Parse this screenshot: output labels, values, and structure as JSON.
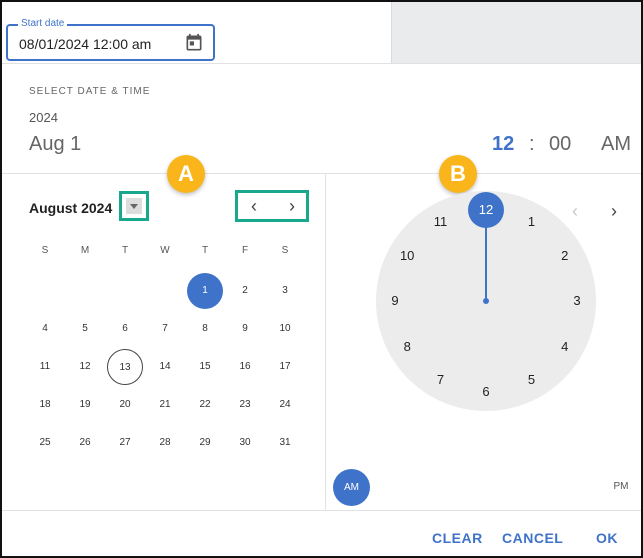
{
  "start_date": {
    "label": "Start date",
    "value": "08/01/2024 12:00 am",
    "icon": "calendar-icon"
  },
  "picker": {
    "toolbar_title": "SELECT DATE & TIME",
    "year": "2024",
    "date": "Aug 1",
    "time": {
      "hour": "12",
      "separator": ":",
      "minute": "00",
      "ampm": "AM"
    }
  },
  "calendar": {
    "month_label": "August 2024",
    "weekdays": [
      "S",
      "M",
      "T",
      "W",
      "T",
      "F",
      "S"
    ],
    "weeks": [
      [
        "",
        "",
        "",
        "",
        "1",
        "2",
        "3"
      ],
      [
        "4",
        "5",
        "6",
        "7",
        "8",
        "9",
        "10"
      ],
      [
        "11",
        "12",
        "13",
        "14",
        "15",
        "16",
        "17"
      ],
      [
        "18",
        "19",
        "20",
        "21",
        "22",
        "23",
        "24"
      ],
      [
        "25",
        "26",
        "27",
        "28",
        "29",
        "30",
        "31"
      ]
    ],
    "selected_day": "1",
    "today": "13",
    "prev": "‹",
    "next": "›"
  },
  "clock": {
    "numbers": [
      "12",
      "1",
      "2",
      "3",
      "4",
      "5",
      "6",
      "7",
      "8",
      "9",
      "10",
      "11"
    ],
    "selected": "12",
    "prev": "‹",
    "next": "›",
    "am": "AM",
    "pm": "PM"
  },
  "markers": {
    "a": "A",
    "b": "B"
  },
  "actions": {
    "clear": "CLEAR",
    "cancel": "CANCEL",
    "ok": "OK"
  },
  "colors": {
    "accent": "#3f73c9",
    "highlight": "#19a88d",
    "marker": "#f9b51a"
  }
}
